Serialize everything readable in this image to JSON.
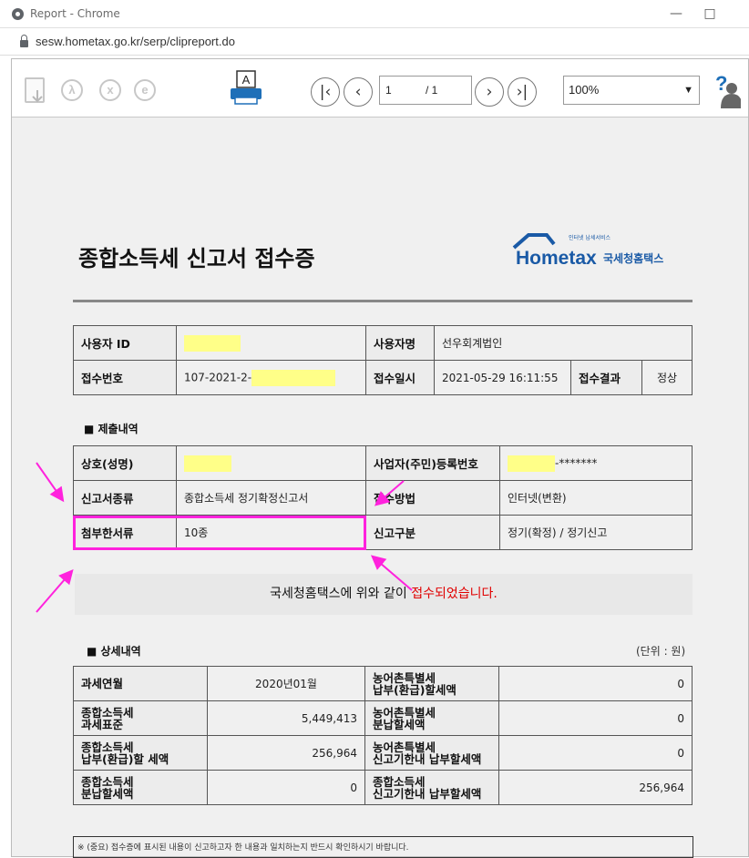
{
  "window": {
    "title": "Report - Chrome",
    "url": "sesw.hometax.go.kr/serp/clipreport.do"
  },
  "toolbar": {
    "icons": [
      "save-icon",
      "pdf-icon",
      "excel-icon",
      "hwp-icon",
      "print-icon",
      "first-page-icon",
      "prev-page-icon",
      "next-page-icon",
      "last-page-icon",
      "help-icon"
    ],
    "page_current": "1",
    "page_total": "/ 1",
    "zoom": "100%",
    "printer_letter": "A",
    "help_glyph": "?"
  },
  "document": {
    "title": "종합소득세 신고서 접수증",
    "logo": {
      "tagline": "인터넷 납세서비스",
      "brand": "Hometax",
      "org": "국세청홈택스"
    },
    "info": {
      "user_id_label": "사용자 ID",
      "user_name_label": "사용자명",
      "user_name": "선우회계법인",
      "receipt_no_label": "접수번호",
      "receipt_no": "107-2021-2-",
      "receipt_dt_label": "접수일시",
      "receipt_dt": "2021-05-29 16:11:55",
      "result_label": "접수결과",
      "result": "정상"
    },
    "submission": {
      "heading": "■ 제출내역",
      "trade_name_label": "상호(성명)",
      "reg_no_label": "사업자(주민)등록번호",
      "reg_no_masked": "-*******",
      "report_type_label": "신고서종류",
      "report_type": "종합소득세 정기확정신고서",
      "method_label": "접수방법",
      "method": "인터넷(변환)",
      "attached_label": "첨부한서류",
      "attached": "10종",
      "category_label": "신고구분",
      "category": "정기(확정) / 정기신고"
    },
    "banner": {
      "text": "국세청홈택스에 위와 같이 ",
      "highlight": "접수되었습니다."
    },
    "details": {
      "heading": "■ 상세내역",
      "unit": "(단위 : 원)",
      "rows": [
        {
          "l1": "과세연월",
          "v1": "2020년01월",
          "l2a": "농어촌특별세",
          "l2b": "납부(환급)할세액",
          "v2": "0"
        },
        {
          "l1a": "종합소득세",
          "l1b": "과세표준",
          "v1": "5,449,413",
          "l2a": "농어촌특별세",
          "l2b": "분납할세액",
          "v2": "0"
        },
        {
          "l1a": "종합소득세",
          "l1b": "납부(환급)할 세액",
          "v1": "256,964",
          "l2a": "농어촌특별세",
          "l2b": "신고기한내 납부할세액",
          "v2": "0"
        },
        {
          "l1a": "종합소득세",
          "l1b": "분납할세액",
          "v1": "0",
          "l2a": "종합소득세",
          "l2b": "신고기한내 납부할세액",
          "v2": "256,964"
        }
      ]
    },
    "notice": "※ (중요) 접수증에 표시된 내용이 신고하고자 한 내용과 일치하는지 반드시 확인하시기 바랍니다."
  },
  "colors": {
    "annotation": "#ff22dd",
    "highlight": "#ffff88",
    "accent_red": "#e00000",
    "hometax_blue": "#1a5aa6"
  }
}
